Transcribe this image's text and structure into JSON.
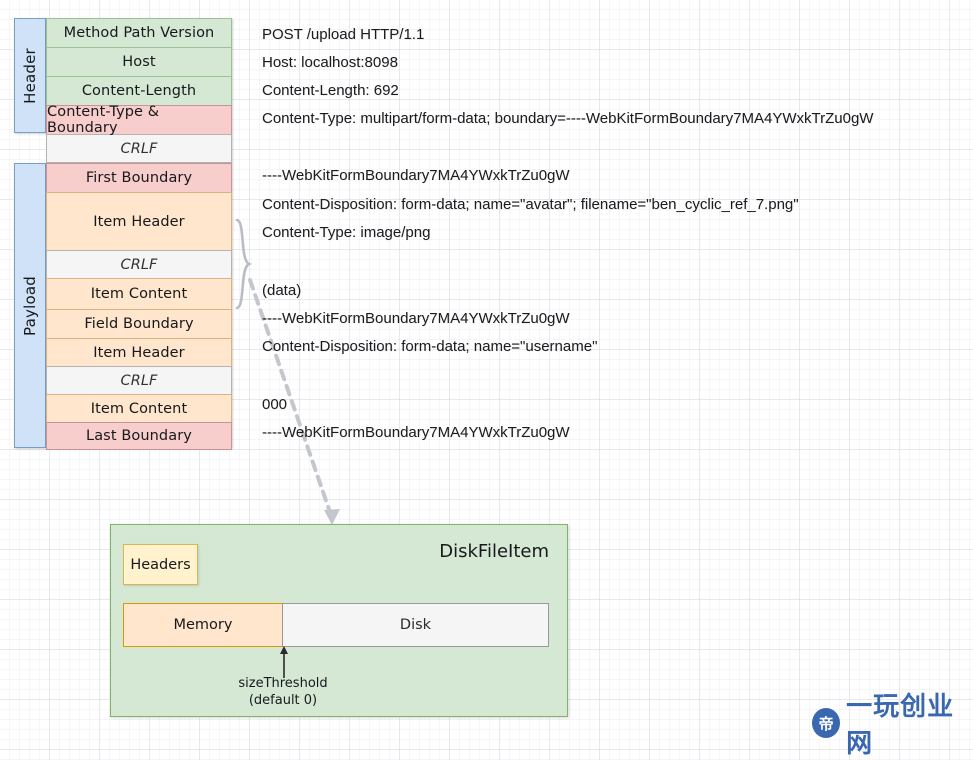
{
  "diagram": {
    "title": "HTTP multipart/form-data request structure",
    "colors": {
      "green": "#d5e8d4",
      "green_border": "#82b366",
      "red": "#f8cecc",
      "red_border": "#b85450",
      "orange": "#ffe6cc",
      "orange_border": "#d79b00",
      "yellow": "#fff2cc",
      "yellow_border": "#d6b656",
      "grey": "#f5f5f5",
      "grey_border": "#999999",
      "blue": "#cfe2f7",
      "blue_border": "#6c8ebf",
      "watermark": "#2a5caa"
    }
  },
  "header_section": {
    "label": "Header",
    "rows": [
      {
        "label": "Method Path Version",
        "style": "green"
      },
      {
        "label": "Host",
        "style": "green"
      },
      {
        "label": "Content-Length",
        "style": "green"
      },
      {
        "label": "Content-Type & Boundary",
        "style": "red"
      },
      {
        "label": "CRLF",
        "style": "white"
      }
    ]
  },
  "payload_section": {
    "label": "Payload",
    "rows": [
      {
        "label": "First Boundary",
        "style": "red"
      },
      {
        "label": "Item Header",
        "style": "orange"
      },
      {
        "label": "CRLF",
        "style": "white"
      },
      {
        "label": "Item Content",
        "style": "orange"
      },
      {
        "label": "Field Boundary",
        "style": "orange"
      },
      {
        "label": "Item Header",
        "style": "orange"
      },
      {
        "label": "CRLF",
        "style": "white"
      },
      {
        "label": "Item Content",
        "style": "orange"
      },
      {
        "label": "Last Boundary",
        "style": "red"
      }
    ]
  },
  "raw_request": {
    "lines": [
      "POST /upload HTTP/1.1",
      "Host: localhost:8098",
      "Content-Length: 692",
      "Content-Type: multipart/form-data; boundary=----WebKitFormBoundary7MA4YWxkTrZu0gW",
      "----WebKitFormBoundary7MA4YWxkTrZu0gW",
      "Content-Disposition: form-data; name=\"avatar\"; filename=\"ben_cyclic_ref_7.png\"",
      "Content-Type: image/png",
      "(data)",
      "----WebKitFormBoundary7MA4YWxkTrZu0gW",
      "Content-Disposition: form-data; name=\"username\"",
      "000",
      "----WebKitFormBoundary7MA4YWxkTrZu0gW"
    ]
  },
  "disk_file_item": {
    "title": "DiskFileItem",
    "headers_label": "Headers",
    "memory_label": "Memory",
    "disk_label": "Disk",
    "threshold_label": "sizeThreshold",
    "threshold_default": "(default 0)"
  },
  "watermark": {
    "badge": "帝",
    "text": "一玩创业网"
  }
}
